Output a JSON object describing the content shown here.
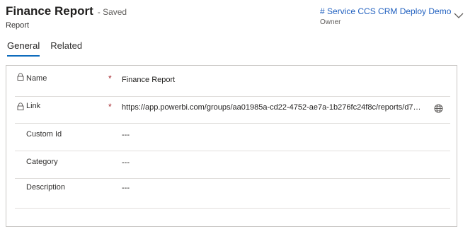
{
  "header": {
    "title": "Finance Report",
    "saved_status": "- Saved",
    "entity_type": "Report"
  },
  "owner": {
    "name": "# Service CCS CRM Deploy Demo",
    "label": "Owner"
  },
  "tabs": [
    {
      "label": "General",
      "active": true
    },
    {
      "label": "Related",
      "active": false
    }
  ],
  "fields": {
    "name": {
      "label": "Name",
      "required": "*",
      "value": "Finance Report",
      "locked": true
    },
    "link": {
      "label": "Link",
      "required": "*",
      "value": "https://app.powerbi.com/groups/aa01985a-cd22-4752-ae7a-1b276fc24f8c/reports/d7…",
      "locked": true
    },
    "custom_id": {
      "label": "Custom Id",
      "value": "---"
    },
    "category": {
      "label": "Category",
      "value": "---"
    },
    "description": {
      "label": "Description",
      "value": "---"
    }
  },
  "colors": {
    "accent": "#0f6cbd",
    "link": "#1f5fbf",
    "required": "#a4262c",
    "border": "#c8c6c4"
  },
  "icons": [
    "lock-icon",
    "globe-icon",
    "chevron-down-icon"
  ]
}
